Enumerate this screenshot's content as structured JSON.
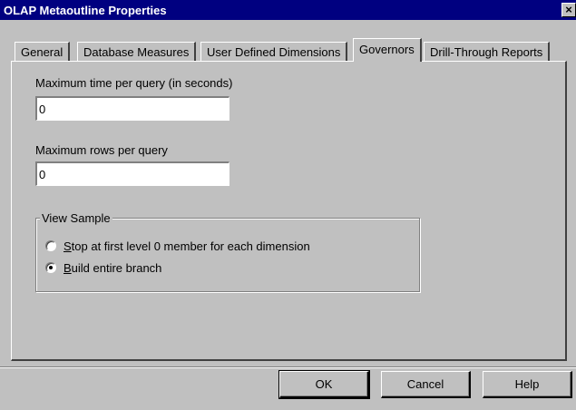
{
  "window": {
    "title": "OLAP Metaoutline Properties",
    "close_glyph": "×"
  },
  "tabs": [
    {
      "label": "General",
      "active": false
    },
    {
      "label": "Database Measures",
      "active": false
    },
    {
      "label": "User Defined Dimensions",
      "active": false
    },
    {
      "label": "Governors",
      "active": true
    },
    {
      "label": "Drill-Through Reports",
      "active": false
    }
  ],
  "governors": {
    "max_time_label": "Maximum time per query (in seconds)",
    "max_time_value": "0",
    "max_rows_label": "Maximum rows per query",
    "max_rows_value": "0"
  },
  "view_sample": {
    "title": "View Sample",
    "options": [
      {
        "mnemonic": "S",
        "label_rest": "top at first level 0 member for each dimension",
        "selected": false
      },
      {
        "mnemonic": "B",
        "label_rest": "uild entire branch",
        "selected": true
      }
    ]
  },
  "buttons": {
    "ok": "OK",
    "cancel": "Cancel",
    "help": "Help"
  },
  "colors": {
    "titlebar": "#000080",
    "face": "#c0c0c0"
  }
}
